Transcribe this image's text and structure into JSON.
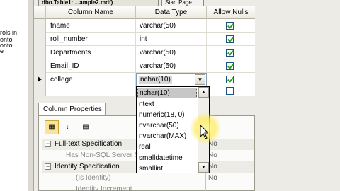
{
  "window": {
    "active_tab": "dbo.Table1: ...ample2.mdf)",
    "inactive_tab": "Start Page"
  },
  "left_panel": {
    "fragments": [
      "rols in",
      "onto",
      "onto",
      "e"
    ]
  },
  "grid": {
    "headers": {
      "name": "Column Name",
      "type": "Data Type",
      "nulls": "Allow Nulls"
    },
    "rows": [
      {
        "name": "fname",
        "type": "varchar(50)",
        "allow_nulls": true
      },
      {
        "name": "roll_number",
        "type": "int",
        "allow_nulls": true
      },
      {
        "name": "Departments",
        "type": "varchar(50)",
        "allow_nulls": true
      },
      {
        "name": "Email_ID",
        "type": "varchar(50)",
        "allow_nulls": true
      },
      {
        "name": "college",
        "type": "nchar(10)",
        "allow_nulls": true
      }
    ]
  },
  "type_dropdown": {
    "options": [
      "nchar(10)",
      "ntext",
      "numeric(18, 0)",
      "nvarchar(50)",
      "nvarchar(MAX)",
      "real",
      "smalldatetime",
      "smallint"
    ],
    "selected": "nchar(10)"
  },
  "properties": {
    "tab_label": "Column Properties",
    "rows": [
      {
        "label": "Full-text Specification",
        "value": "No",
        "kind": "category"
      },
      {
        "label": "Has Non-SQL Server Subscriber",
        "value": "No",
        "kind": "sub"
      },
      {
        "label": "Identity Specification",
        "value": "No",
        "kind": "category"
      },
      {
        "label": "(Is Identity)",
        "value": "No",
        "kind": "sub2"
      },
      {
        "label": "Identity Increment",
        "value": "",
        "kind": "sub2"
      }
    ]
  },
  "icons": {
    "categorized": "categorized-icon",
    "alphabetical": "alphabetical-sort-icon",
    "property_pages": "property-pages-icon"
  },
  "colors": {
    "checkbox_check": "#21a121",
    "highlight_glow": "#ffec5a",
    "dropdown_selected": "#c7c7c7"
  }
}
